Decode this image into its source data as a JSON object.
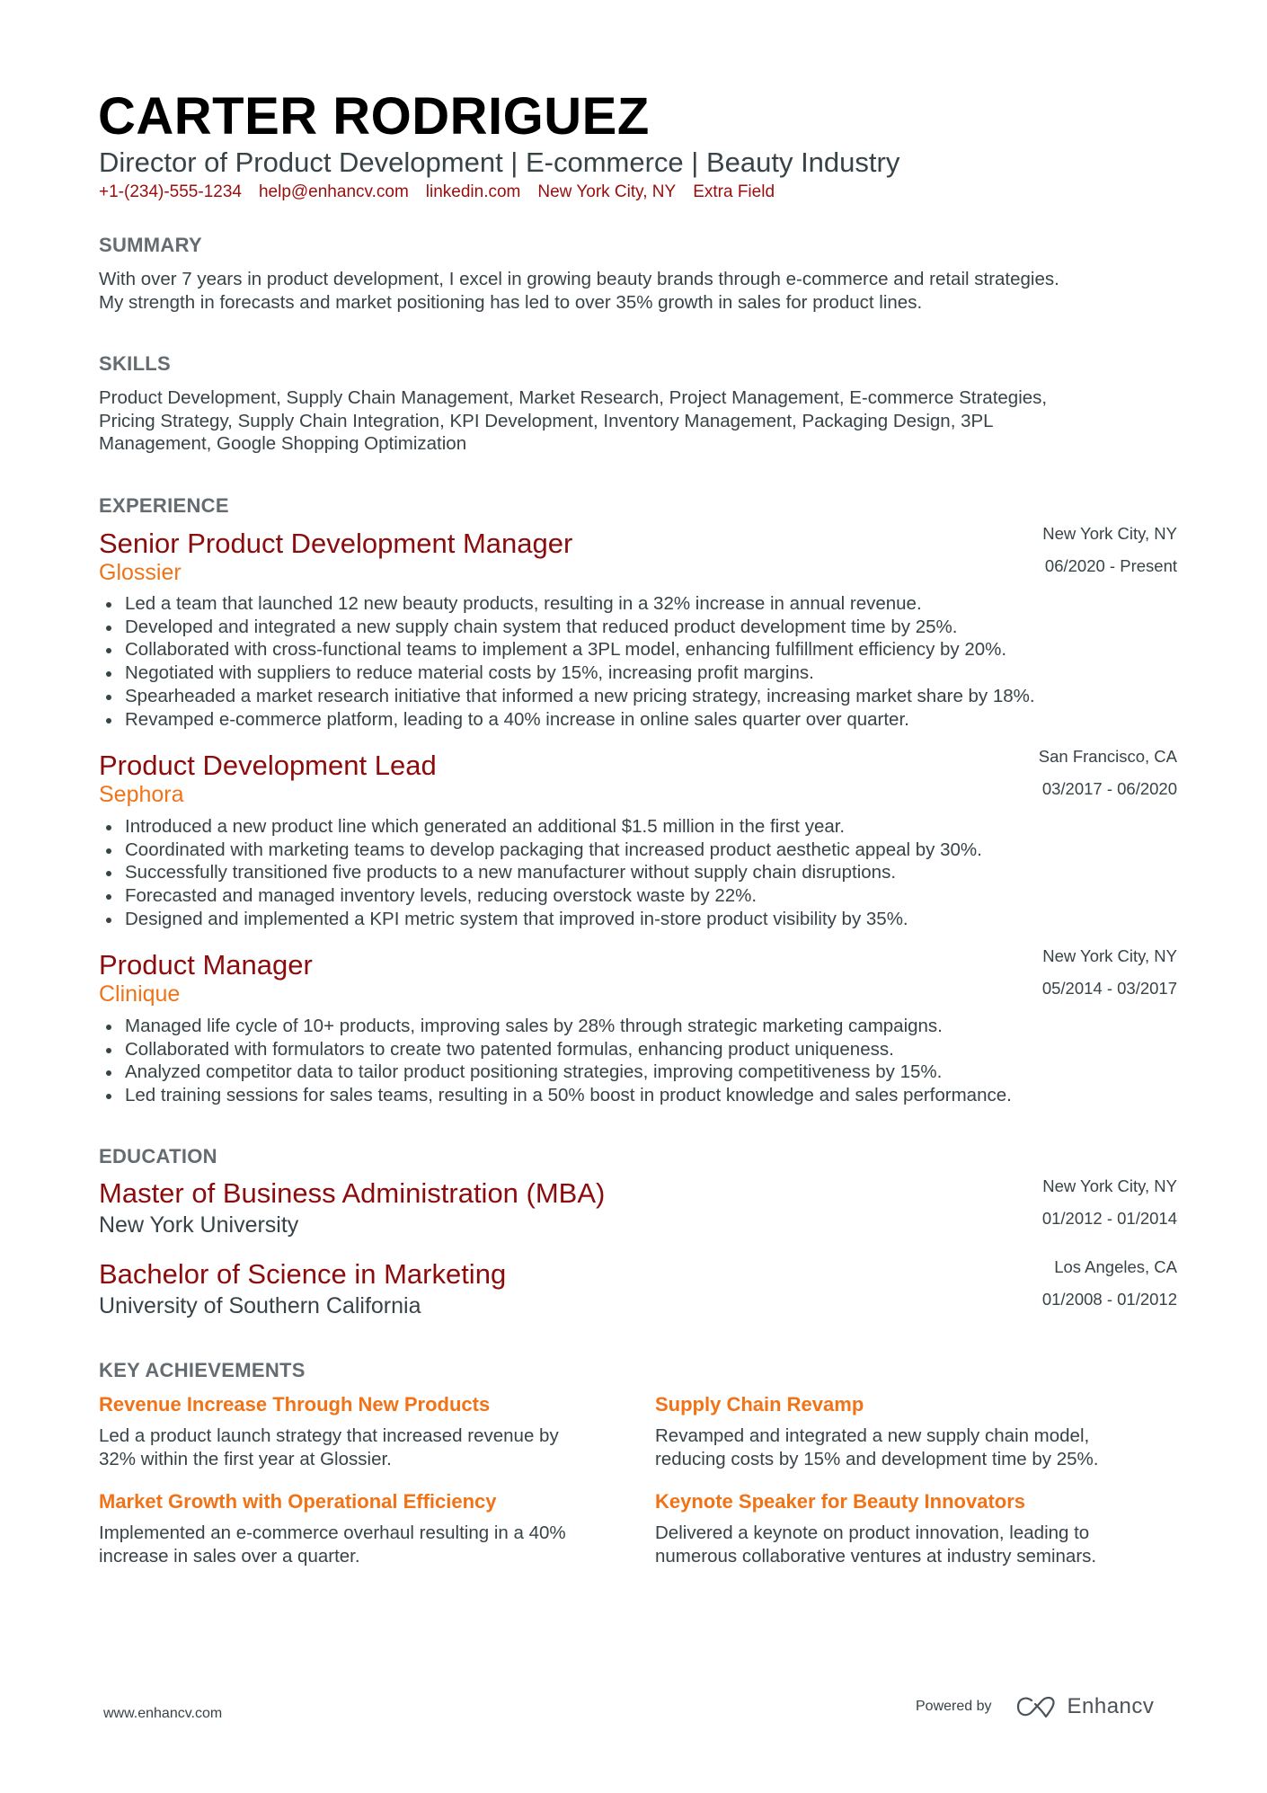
{
  "header": {
    "name": "CARTER RODRIGUEZ",
    "headline": "Director of Product Development | E-commerce | Beauty Industry",
    "contacts": [
      "+1-(234)-555-1234",
      "help@enhancv.com",
      "linkedin.com",
      "New York City, NY",
      "Extra Field"
    ]
  },
  "summary": {
    "title": "SUMMARY",
    "lines": [
      "With over 7 years in product development, I excel in growing beauty brands through e-commerce and retail strategies.",
      "My strength in forecasts and market positioning has led to over 35% growth in sales for product lines."
    ]
  },
  "skills": {
    "title": "SKILLS",
    "lines": [
      "Product Development, Supply Chain Management, Market Research, Project Management, E-commerce Strategies,",
      "Pricing Strategy, Supply Chain Integration, KPI Development, Inventory Management, Packaging Design, 3PL",
      "Management, Google Shopping Optimization"
    ]
  },
  "experience": {
    "title": "EXPERIENCE",
    "jobs": [
      {
        "title": "Senior Product Development Manager",
        "company": "Glossier",
        "location": "New York City, NY",
        "dates": "06/2020 - Present",
        "bullets": [
          "Led a team that launched 12 new beauty products, resulting in a 32% increase in annual revenue.",
          "Developed and integrated a new supply chain system that reduced product development time by 25%.",
          "Collaborated with cross-functional teams to implement a 3PL model, enhancing fulfillment efficiency by 20%.",
          "Negotiated with suppliers to reduce material costs by 15%, increasing profit margins.",
          "Spearheaded a market research initiative that informed a new pricing strategy, increasing market share by 18%.",
          "Revamped e-commerce platform, leading to a 40% increase in online sales quarter over quarter."
        ]
      },
      {
        "title": "Product Development Lead",
        "company": "Sephora",
        "location": "San Francisco, CA",
        "dates": "03/2017 - 06/2020",
        "bullets": [
          "Introduced a new product line which generated an additional $1.5 million in the first year.",
          "Coordinated with marketing teams to develop packaging that increased product aesthetic appeal by 30%.",
          "Successfully transitioned five products to a new manufacturer without supply chain disruptions.",
          "Forecasted and managed inventory levels, reducing overstock waste by 22%.",
          "Designed and implemented a KPI metric system that improved in-store product visibility by 35%."
        ]
      },
      {
        "title": "Product Manager",
        "company": "Clinique",
        "location": "New York City, NY",
        "dates": "05/2014 - 03/2017",
        "bullets": [
          "Managed life cycle of 10+ products, improving sales by 28% through strategic marketing campaigns.",
          "Collaborated with formulators to create two patented formulas, enhancing product uniqueness.",
          "Analyzed competitor data to tailor product positioning strategies, improving competitiveness by 15%.",
          "Led training sessions for sales teams, resulting in a 50% boost in product knowledge and sales performance."
        ]
      }
    ]
  },
  "education": {
    "title": "EDUCATION",
    "items": [
      {
        "degree": "Master of Business Administration (MBA)",
        "school": "New York University",
        "location": "New York City, NY",
        "dates": "01/2012 - 01/2014"
      },
      {
        "degree": "Bachelor of Science in Marketing",
        "school": "University of Southern California",
        "location": "Los Angeles, CA",
        "dates": "01/2008 - 01/2012"
      }
    ]
  },
  "achievements": {
    "title": "KEY ACHIEVEMENTS",
    "items": [
      {
        "title": "Revenue Increase Through New Products",
        "desc": [
          "Led a product launch strategy that increased revenue by",
          "32% within the first year at Glossier."
        ]
      },
      {
        "title": "Supply Chain Revamp",
        "desc": [
          "Revamped and integrated a new supply chain model,",
          "reducing costs by 15% and development time by 25%."
        ]
      },
      {
        "title": "Market Growth with Operational Efficiency",
        "desc": [
          "Implemented an e-commerce overhaul resulting in a 40%",
          "increase in sales over a quarter."
        ]
      },
      {
        "title": "Keynote Speaker for Beauty Innovators",
        "desc": [
          "Delivered a keynote on product innovation, leading to",
          "numerous collaborative ventures at industry seminars."
        ]
      }
    ]
  },
  "footer": {
    "website": "www.enhancv.com",
    "powered_by": "Powered by",
    "brand": "Enhancv",
    "logo_icon": "enhancv-logo-icon"
  },
  "colors": {
    "accent_dark_red": "#8b0c0c",
    "accent_orange": "#f07318",
    "section_gray": "#646c71",
    "text": "#384347"
  }
}
